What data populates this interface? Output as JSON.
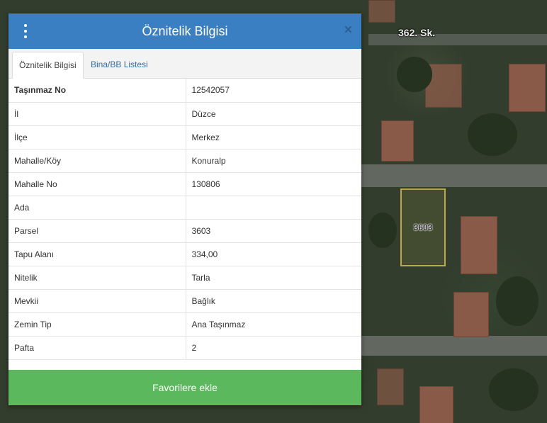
{
  "map": {
    "street_label": "362. Sk.",
    "parcel_label": "3603"
  },
  "panel": {
    "title": "Öznitelik Bilgisi",
    "close_symbol": "×",
    "menu_icon": "vertical-dots-icon",
    "tabs": [
      {
        "label": "Öznitelik Bilgisi",
        "active": true
      },
      {
        "label": "Bina/BB Listesi",
        "active": false
      }
    ],
    "rows": [
      {
        "key": "Taşınmaz No",
        "value": "12542057"
      },
      {
        "key": "İl",
        "value": "Düzce"
      },
      {
        "key": "İlçe",
        "value": "Merkez"
      },
      {
        "key": "Mahalle/Köy",
        "value": "Konuralp"
      },
      {
        "key": "Mahalle No",
        "value": "130806"
      },
      {
        "key": "Ada",
        "value": ""
      },
      {
        "key": "Parsel",
        "value": "3603"
      },
      {
        "key": "Tapu Alanı",
        "value": "334,00"
      },
      {
        "key": "Nitelik",
        "value": "Tarla"
      },
      {
        "key": "Mevkii",
        "value": "Bağlık"
      },
      {
        "key": "Zemin Tip",
        "value": "Ana Taşınmaz"
      },
      {
        "key": "Pafta",
        "value": "2"
      }
    ],
    "favorite_button": "Favorilere ekle"
  },
  "colors": {
    "header": "#3a7fc1",
    "button": "#5cb85c",
    "tab_link": "#2f6ea6"
  }
}
